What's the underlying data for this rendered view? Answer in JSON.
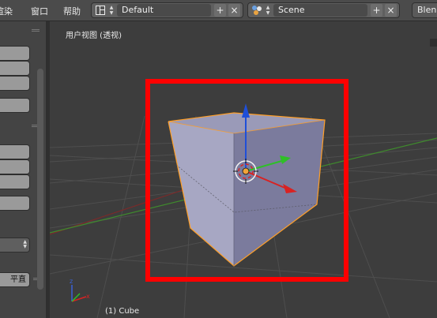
{
  "menu": {
    "render": "渲染",
    "window": "窗口",
    "help": "帮助"
  },
  "screen_layout": {
    "value": "Default",
    "add": "+",
    "close": "×"
  },
  "scene": {
    "value": "Scene",
    "add": "+",
    "close": "×"
  },
  "render_engine": {
    "value": "Blender"
  },
  "left_panel": {
    "snap_button_label": "平直"
  },
  "viewport": {
    "view_label": "用户视图 (透视)",
    "object_label": "(1) Cube"
  },
  "highlight_color": "#ff0000",
  "cube_outline_color": "#ff9f28"
}
